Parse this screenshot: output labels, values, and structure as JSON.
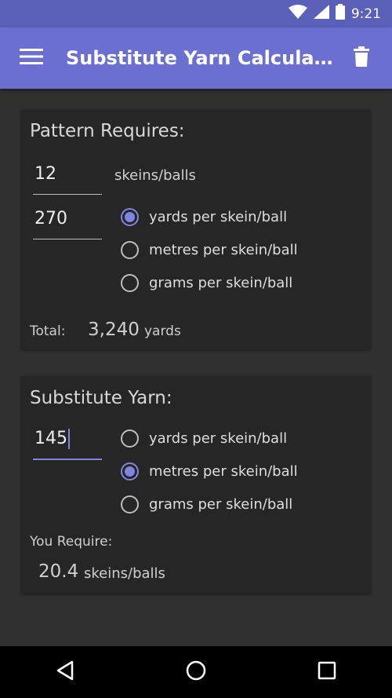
{
  "status_bar": {
    "time": "9:21"
  },
  "app_bar": {
    "title": "Substitute Yarn Calculatio…"
  },
  "pattern": {
    "heading": "Pattern Requires:",
    "skeins_value": "12",
    "skeins_unit": "skeins/balls",
    "length_value": "270",
    "options": [
      {
        "label": "yards per skein/ball",
        "checked": true
      },
      {
        "label": "metres per skein/ball",
        "checked": false
      },
      {
        "label": "grams per skein/ball",
        "checked": false
      }
    ],
    "total_label": "Total:",
    "total_value": "3,240",
    "total_unit": "yards"
  },
  "substitute": {
    "heading": "Substitute Yarn:",
    "length_value": "145",
    "options": [
      {
        "label": "yards per skein/ball",
        "checked": false
      },
      {
        "label": "metres per skein/ball",
        "checked": true
      },
      {
        "label": "grams per skein/ball",
        "checked": false
      }
    ],
    "require_label": "You Require:",
    "require_value": "20.4",
    "require_unit": "skeins/balls"
  },
  "colors": {
    "primary": "#6a6fd0",
    "primary_dark": "#5a5fb8",
    "accent": "#7f84e0"
  }
}
